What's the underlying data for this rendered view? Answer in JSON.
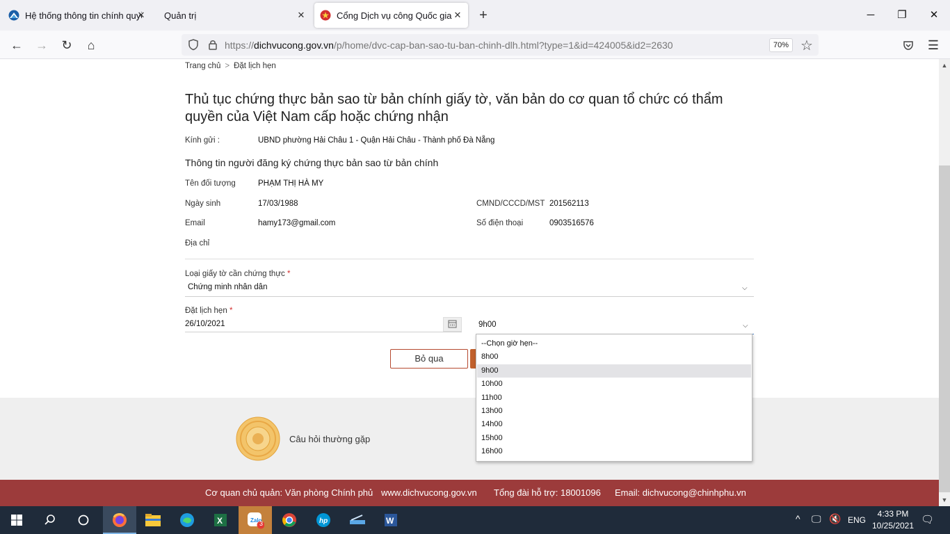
{
  "browser": {
    "tabs": [
      {
        "title": "Hệ thống thông tin chính quyền",
        "icon": "site-icon"
      },
      {
        "title": "Quản trị",
        "icon": "none"
      },
      {
        "title": "Cổng Dịch vụ công Quốc gia",
        "icon": "national-emblem-icon",
        "active": true
      }
    ],
    "url_prefix": "https://",
    "url_host": "dichvucong.gov.vn",
    "url_path": "/p/home/dvc-cap-ban-sao-tu-ban-chinh-dlh.html?type=1&id=424005&id2=2630",
    "zoom": "70%"
  },
  "breadcrumb": {
    "home": "Trang chủ",
    "sep": ">",
    "current": "Đặt lịch hẹn"
  },
  "page": {
    "title": "Thủ tục chứng thực bản sao từ bản chính giấy tờ, văn bản do cơ quan tổ chức có thẩm quyền của Việt Nam cấp hoặc chứng nhận",
    "recipient_label": "Kính gửi :",
    "recipient_value": "UBND phường Hải Châu 1 - Quận Hải Châu - Thành phố Đà Nẵng",
    "section_title": "Thông tin người đăng ký chứng thực bản sao từ bản chính",
    "person": {
      "name_label": "Tên đối tượng",
      "name_value": "PHẠM THỊ HÀ MY",
      "dob_label": "Ngày sinh",
      "dob_value": "17/03/1988",
      "id_label": "CMND/CCCD/MST",
      "id_value": "201562113",
      "email_label": "Email",
      "email_value": "hamy173@gmail.com",
      "phone_label": "Số điện thoại",
      "phone_value": "0903516576",
      "address_label": "Địa chỉ"
    },
    "doc_type": {
      "label": "Loại giấy tờ cần chứng thực",
      "required": "*",
      "value": "Chứng minh nhân dân"
    },
    "appointment": {
      "label": "Đặt lịch hẹn",
      "required": "*",
      "date": "26/10/2021",
      "time": "9h00"
    },
    "buttons": {
      "cancel": "Bỏ qua"
    },
    "time_options": [
      "--Chọn giờ hẹn--",
      "8h00",
      "9h00",
      "10h00",
      "11h00",
      "13h00",
      "14h00",
      "15h00",
      "16h00"
    ],
    "selected_time_index": 2
  },
  "faq": {
    "label": "Câu hỏi thường gặp"
  },
  "footer": {
    "owner": "Cơ quan chủ quản: Văn phòng Chính phủ",
    "site": "www.dichvucong.gov.vn",
    "hotline": "Tổng đài hỗ trợ: 18001096",
    "email": "Email: dichvucong@chinhphu.vn"
  },
  "taskbar": {
    "time": "4:33 PM",
    "date": "10/25/2021",
    "lang": "ENG",
    "zalo_badge": "3"
  },
  "colors": {
    "footer_red": "#9c3b3b",
    "accent_orange": "#c1602c",
    "required_red": "#d32f2f"
  }
}
